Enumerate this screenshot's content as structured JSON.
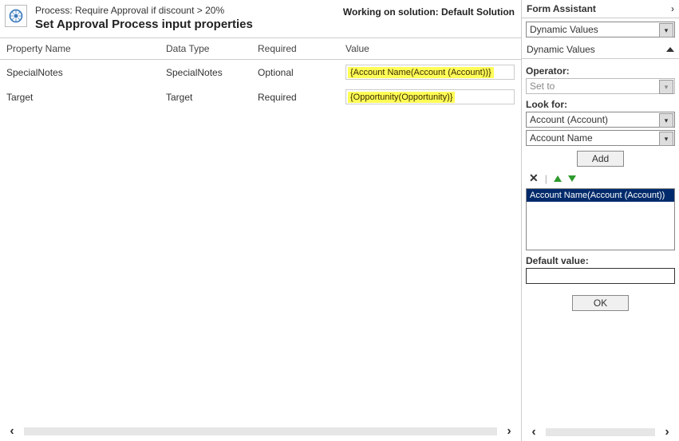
{
  "header": {
    "process_label_prefix": "Process: ",
    "process_name": "Require Approval if discount > 20%",
    "title": "Set Approval Process input properties",
    "solution_prefix": "Working on solution: ",
    "solution_name": "Default Solution"
  },
  "columns": {
    "property": "Property Name",
    "data_type": "Data Type",
    "required": "Required",
    "value": "Value"
  },
  "rows": [
    {
      "property": "SpecialNotes",
      "data_type": "SpecialNotes",
      "required": "Optional",
      "value_chip": "{Account Name(Account (Account))}"
    },
    {
      "property": "Target",
      "data_type": "Target",
      "required": "Required",
      "value_chip": "{Opportunity(Opportunity)}"
    }
  ],
  "assistant": {
    "header": "Form Assistant",
    "section_select": "Dynamic Values",
    "section_label": "Dynamic Values",
    "operator_label": "Operator:",
    "operator_value": "Set to",
    "lookfor_label": "Look for:",
    "lookfor_entity": "Account (Account)",
    "lookfor_attr": "Account Name",
    "add_label": "Add",
    "list_selected": "Account Name(Account (Account))",
    "default_label": "Default value:",
    "default_value": "",
    "ok_label": "OK"
  }
}
